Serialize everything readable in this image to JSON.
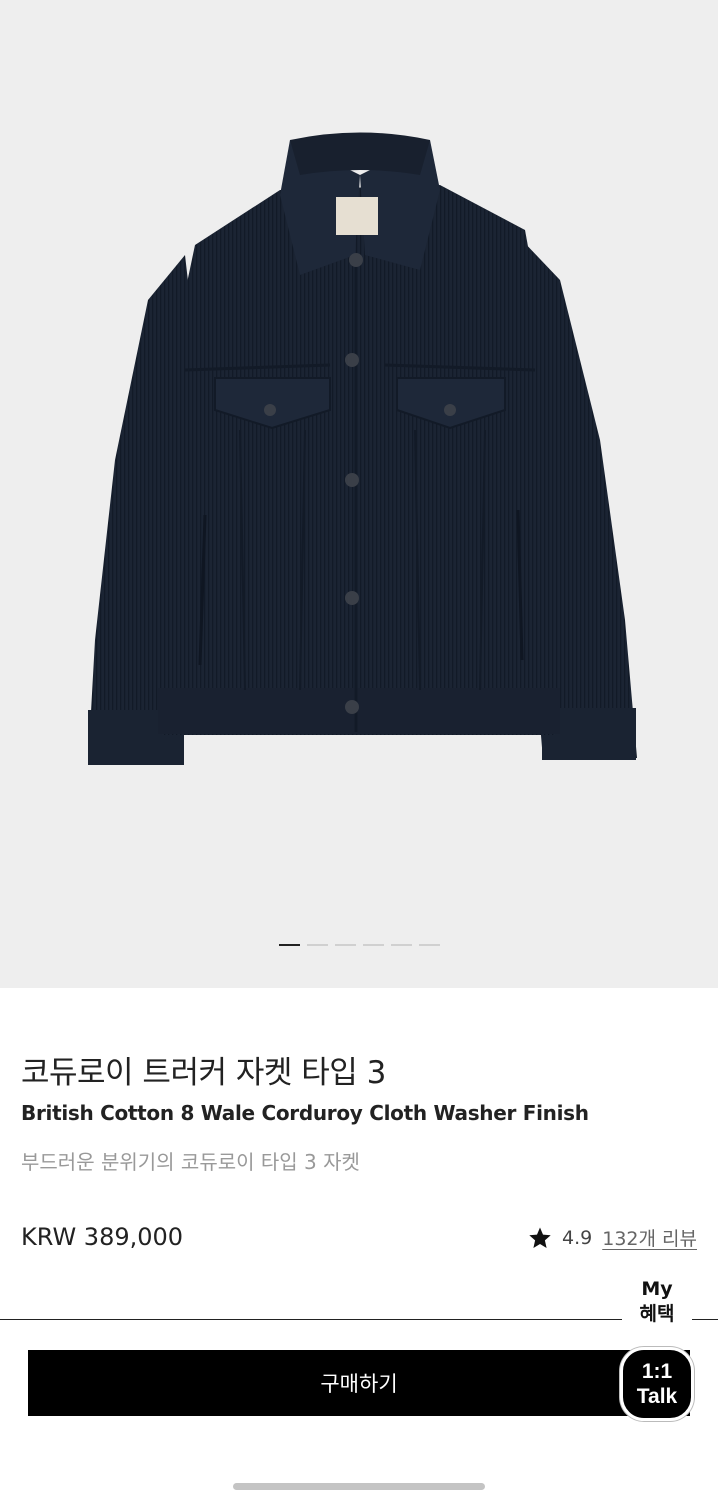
{
  "product": {
    "title": "코듀로이 트러커 자켓 타입 3",
    "subtitle": "British Cotton 8 Wale Corduroy Cloth Washer Finish",
    "description": "부드러운 분위기의 코듀로이 타입 3 자켓",
    "price": "KRW 389,000",
    "rating": "4.9",
    "review_link": "132개 리뷰",
    "image_icon": "navy-corduroy-trucker-jacket"
  },
  "gallery": {
    "pages": 6,
    "active_index": 0
  },
  "benefit": {
    "line1": "My",
    "line2": "혜택"
  },
  "buy_button": {
    "label": "구매하기"
  },
  "talk_button": {
    "line1": "1:1",
    "line2": "Talk"
  },
  "colors": {
    "jacket": "#1b2433",
    "background": "#eeeeee",
    "button": "#000000"
  }
}
